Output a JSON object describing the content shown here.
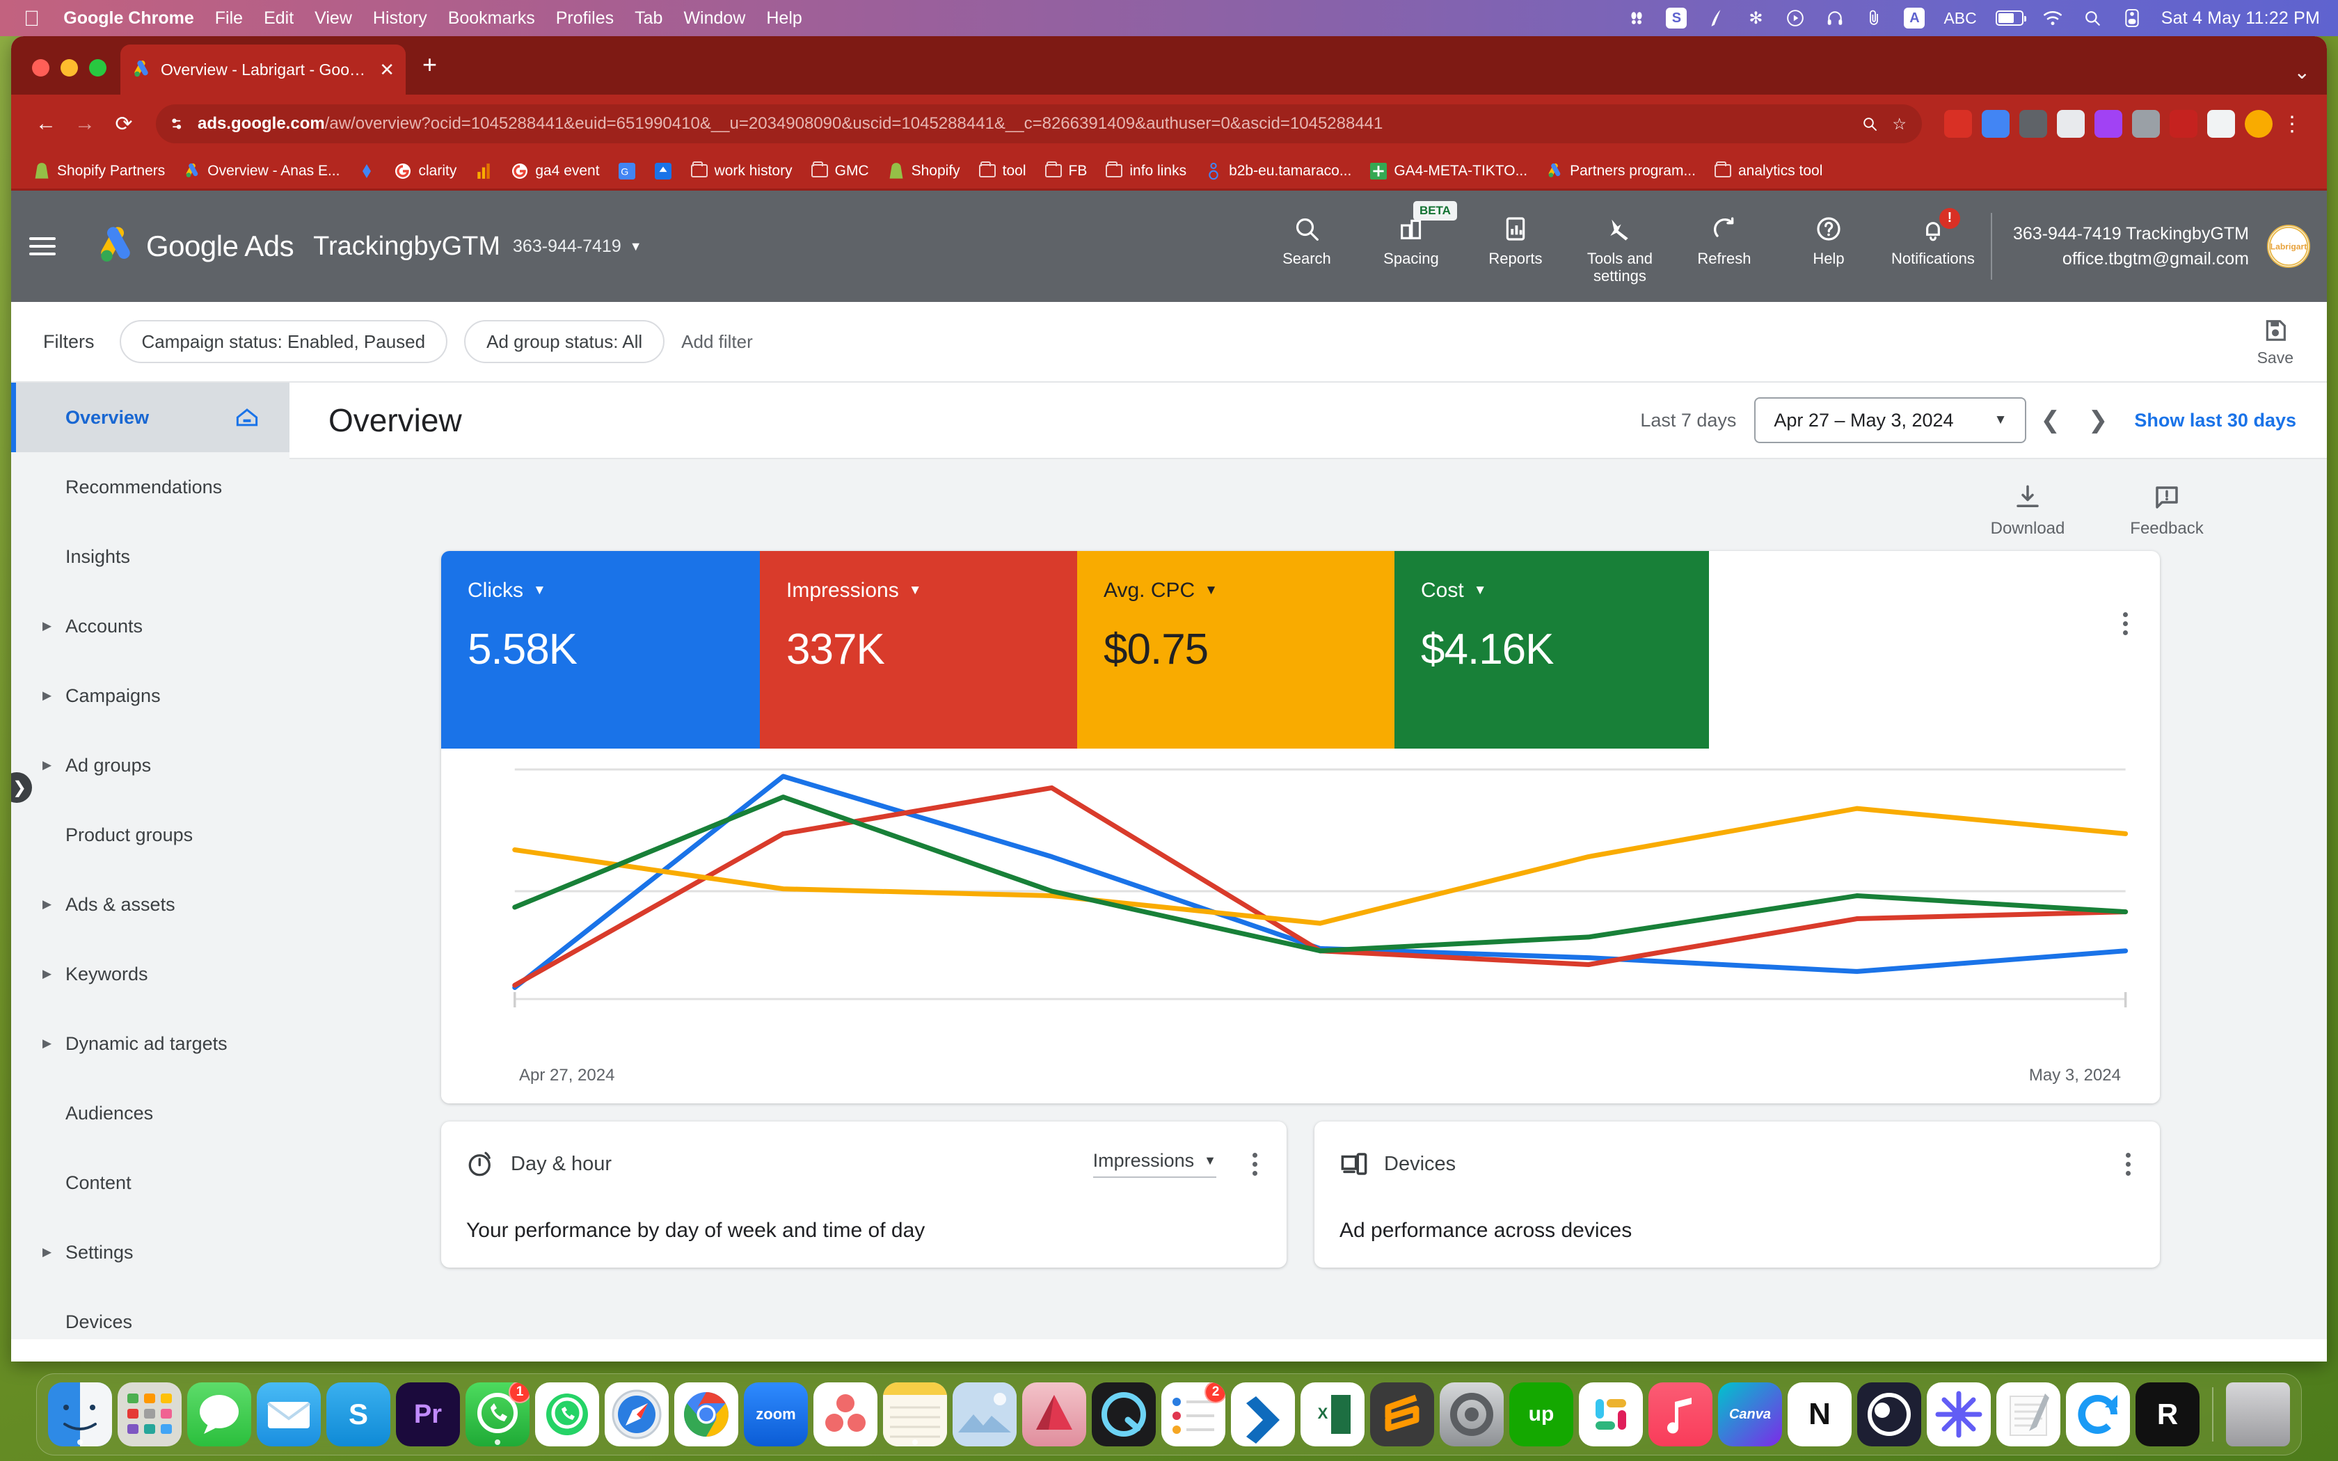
{
  "os": {
    "menubar": {
      "apple_icon": "apple-icon",
      "items": [
        "Google Chrome",
        "File",
        "Edit",
        "View",
        "History",
        "Bookmarks",
        "Profiles",
        "Tab",
        "Window",
        "Help"
      ],
      "status_icons": [
        "bartender-icon",
        "spotify-icon",
        "grammarly-icon",
        "snowflake-icon",
        "player-icon",
        "headphones-icon",
        "clipboard-icon",
        "abc-input-icon",
        "battery-icon",
        "wifi-icon",
        "search-icon",
        "controlcenter-icon"
      ],
      "abc_label": "ABC",
      "clock": "Sat 4 May  11:22 PM"
    },
    "dock": {
      "items": [
        {
          "name": "finder",
          "badge": null
        },
        {
          "name": "launchpad",
          "badge": null
        },
        {
          "name": "messages",
          "badge": null
        },
        {
          "name": "mail",
          "badge": null
        },
        {
          "name": "skype",
          "badge": null
        },
        {
          "name": "premiere-pro",
          "badge": null
        },
        {
          "name": "whatsapp-business",
          "badge": "1"
        },
        {
          "name": "whatsapp",
          "badge": null
        },
        {
          "name": "safari",
          "badge": null
        },
        {
          "name": "google-chrome",
          "badge": null
        },
        {
          "name": "zoom",
          "badge": null
        },
        {
          "name": "asana",
          "badge": null
        },
        {
          "name": "notes",
          "badge": null
        },
        {
          "name": "photos",
          "badge": null
        },
        {
          "name": "affinity",
          "badge": null
        },
        {
          "name": "quicktime",
          "badge": null
        },
        {
          "name": "reminders",
          "badge": "2"
        },
        {
          "name": "vs-code",
          "badge": null
        },
        {
          "name": "excel",
          "badge": null
        },
        {
          "name": "sublime-text",
          "badge": null
        },
        {
          "name": "system-settings",
          "badge": null
        },
        {
          "name": "upwork",
          "badge": null
        },
        {
          "name": "slack",
          "badge": null
        },
        {
          "name": "apple-music",
          "badge": null
        },
        {
          "name": "canva",
          "badge": null
        },
        {
          "name": "notion",
          "badge": null
        },
        {
          "name": "obs",
          "badge": null
        },
        {
          "name": "loom",
          "badge": null
        },
        {
          "name": "pages",
          "badge": null
        },
        {
          "name": "dropbox-sync",
          "badge": null
        },
        {
          "name": "rstudio",
          "badge": null
        }
      ],
      "trash": "trash"
    }
  },
  "browser": {
    "tab": {
      "title": "Overview - Labrigart - Google",
      "favicon": "google-ads-icon",
      "close_icon": "close-icon"
    },
    "new_tab_label": "+",
    "nav": {
      "back_icon": "back-arrow-icon",
      "forward_icon": "forward-arrow-icon",
      "reload_icon": "reload-icon"
    },
    "url": {
      "domain": "ads.google.com",
      "path": "/aw/overview?ocid=1045288441&euid=651990410&__u=2034908090&uscid=1045288441&__c=8266391409&authuser=0&ascid=1045288441",
      "site_info_icon": "site-settings-icon",
      "zoom_icon": "search-zoom-icon",
      "bookmark_icon": "star-icon"
    },
    "extensions": [
      "extension-1",
      "extension-2",
      "extension-3",
      "extension-4",
      "extension-5",
      "extension-6",
      "extension-7",
      "extension-8",
      "extension-9"
    ],
    "profile_icon": "profile-avatar-icon",
    "menu_icon": "kebab-menu-icon",
    "bookmarks": [
      {
        "label": "Shopify Partners",
        "icon": "shopify-icon"
      },
      {
        "label": "Overview - Anas E...",
        "icon": "google-ads-icon"
      },
      {
        "label": "",
        "icon": "looker-icon"
      },
      {
        "label": "clarity",
        "icon": "google-icon"
      },
      {
        "label": "",
        "icon": "analytics-icon"
      },
      {
        "label": "ga4 event",
        "icon": "google-icon"
      },
      {
        "label": "",
        "icon": "translate-icon"
      },
      {
        "label": "",
        "icon": "app-icon"
      },
      {
        "label": "work history",
        "icon": "folder-icon"
      },
      {
        "label": "GMC",
        "icon": "folder-icon"
      },
      {
        "label": "Shopify",
        "icon": "shopify-icon"
      },
      {
        "label": "tool",
        "icon": "folder-icon"
      },
      {
        "label": "FB",
        "icon": "folder-icon"
      },
      {
        "label": "info links",
        "icon": "folder-icon"
      },
      {
        "label": "b2b-eu.tamaraco...",
        "icon": "link-icon"
      },
      {
        "label": "GA4-META-TIKTO...",
        "icon": "tag-manager-icon"
      },
      {
        "label": "Partners program...",
        "icon": "google-ads-icon"
      },
      {
        "label": "analytics tool",
        "icon": "folder-icon"
      }
    ]
  },
  "ads_header": {
    "menu_icon": "hamburger-icon",
    "logo_icon": "google-ads-logo-icon",
    "wordmark": "Google Ads",
    "account_name": "TrackingbyGTM",
    "account_id": "363-944-7419",
    "account_caret": "chevron-down-icon",
    "tools": [
      {
        "label": "Search",
        "icon": "search-icon",
        "badge": null
      },
      {
        "label": "Spacing",
        "icon": "spacing-icon",
        "badge": "BETA"
      },
      {
        "label": "Reports",
        "icon": "reports-icon",
        "badge": null
      },
      {
        "label": "Tools and settings",
        "icon": "wrench-icon",
        "badge": null
      },
      {
        "label": "Refresh",
        "icon": "refresh-icon",
        "badge": null
      },
      {
        "label": "Help",
        "icon": "help-icon",
        "badge": null
      },
      {
        "label": "Notifications",
        "icon": "bell-icon",
        "badge": "!"
      }
    ],
    "account_line1": "363-944-7419 TrackingbyGTM",
    "account_line2": "office.tbgtm@gmail.com",
    "avatar_text": "Labrigart"
  },
  "filters": {
    "label": "Filters",
    "chips": [
      "Campaign status: Enabled, Paused",
      "Ad group status: All"
    ],
    "add_filter": "Add filter",
    "save": {
      "label": "Save",
      "icon": "save-icon"
    }
  },
  "sidebar": {
    "items": [
      {
        "label": "Overview",
        "active": true,
        "expandable": false,
        "trailing_icon": "home-icon"
      },
      {
        "label": "Recommendations",
        "active": false,
        "expandable": false
      },
      {
        "label": "Insights",
        "active": false,
        "expandable": false
      },
      {
        "label": "Accounts",
        "active": false,
        "expandable": true
      },
      {
        "label": "Campaigns",
        "active": false,
        "expandable": true
      },
      {
        "label": "Ad groups",
        "active": false,
        "expandable": true
      },
      {
        "label": "Product groups",
        "active": false,
        "expandable": false
      },
      {
        "label": "Ads & assets",
        "active": false,
        "expandable": true
      },
      {
        "label": "Keywords",
        "active": false,
        "expandable": true
      },
      {
        "label": "Dynamic ad targets",
        "active": false,
        "expandable": true
      },
      {
        "label": "Audiences",
        "active": false,
        "expandable": false
      },
      {
        "label": "Content",
        "active": false,
        "expandable": false
      },
      {
        "label": "Settings",
        "active": false,
        "expandable": true
      },
      {
        "label": "Devices",
        "active": false,
        "expandable": false
      }
    ],
    "collapse_icon": "chevron-right-icon"
  },
  "page": {
    "title": "Overview",
    "date_label": "Last 7 days",
    "date_value": "Apr 27 – May 3, 2024",
    "date_caret": "chevron-down-icon",
    "prev_icon": "chevron-left-icon",
    "next_icon": "chevron-right-icon",
    "show_30": "Show last 30 days",
    "actions": [
      {
        "label": "Download",
        "icon": "download-icon"
      },
      {
        "label": "Feedback",
        "icon": "feedback-icon"
      }
    ],
    "card_kebab": "kebab-menu-icon"
  },
  "chart_data": {
    "type": "line",
    "title": "",
    "xlabel": "",
    "ylabel": "",
    "x_tick_labels": [
      "Apr 27, 2024",
      "May 3, 2024"
    ],
    "x": [
      "Apr 27, 2024",
      "Apr 28, 2024",
      "Apr 29, 2024",
      "Apr 30, 2024",
      "May 1, 2024",
      "May 2, 2024",
      "May 3, 2024"
    ],
    "grid": true,
    "legend": "scorecards",
    "scorecards": [
      {
        "metric": "Clicks",
        "value": "5.58K",
        "color": "#1a73e8",
        "caret": "chevron-down-icon"
      },
      {
        "metric": "Impressions",
        "value": "337K",
        "color": "#d93b2b",
        "caret": "chevron-down-icon"
      },
      {
        "metric": "Avg. CPC",
        "value": "$0.75",
        "color": "#f9ab00",
        "caret": "chevron-down-icon"
      },
      {
        "metric": "Cost",
        "value": "$4.16K",
        "color": "#188038",
        "caret": "chevron-down-icon"
      }
    ],
    "series": [
      {
        "name": "Clicks",
        "color": "#1a73e8",
        "values": [
          5,
          97,
          62,
          22,
          18,
          12,
          21
        ]
      },
      {
        "name": "Impressions",
        "color": "#d93b2b",
        "values": [
          6,
          72,
          92,
          21,
          15,
          35,
          38
        ]
      },
      {
        "name": "Avg. CPC",
        "color": "#f9ab00",
        "values": [
          65,
          48,
          45,
          33,
          62,
          83,
          72
        ]
      },
      {
        "name": "Cost",
        "color": "#188038",
        "values": [
          40,
          88,
          47,
          21,
          27,
          45,
          38
        ]
      }
    ],
    "ylim": [
      0,
      100
    ]
  },
  "bottom_cards": [
    {
      "title": "Day & hour",
      "icon": "clock-icon",
      "selector": "Impressions",
      "selector_caret": "chevron-down-icon",
      "kebab": "kebab-menu-icon",
      "subtitle": "Your performance by day of week and time of day"
    },
    {
      "title": "Devices",
      "icon": "devices-icon",
      "selector": null,
      "kebab": "kebab-menu-icon",
      "subtitle": "Ad performance across devices"
    }
  ]
}
